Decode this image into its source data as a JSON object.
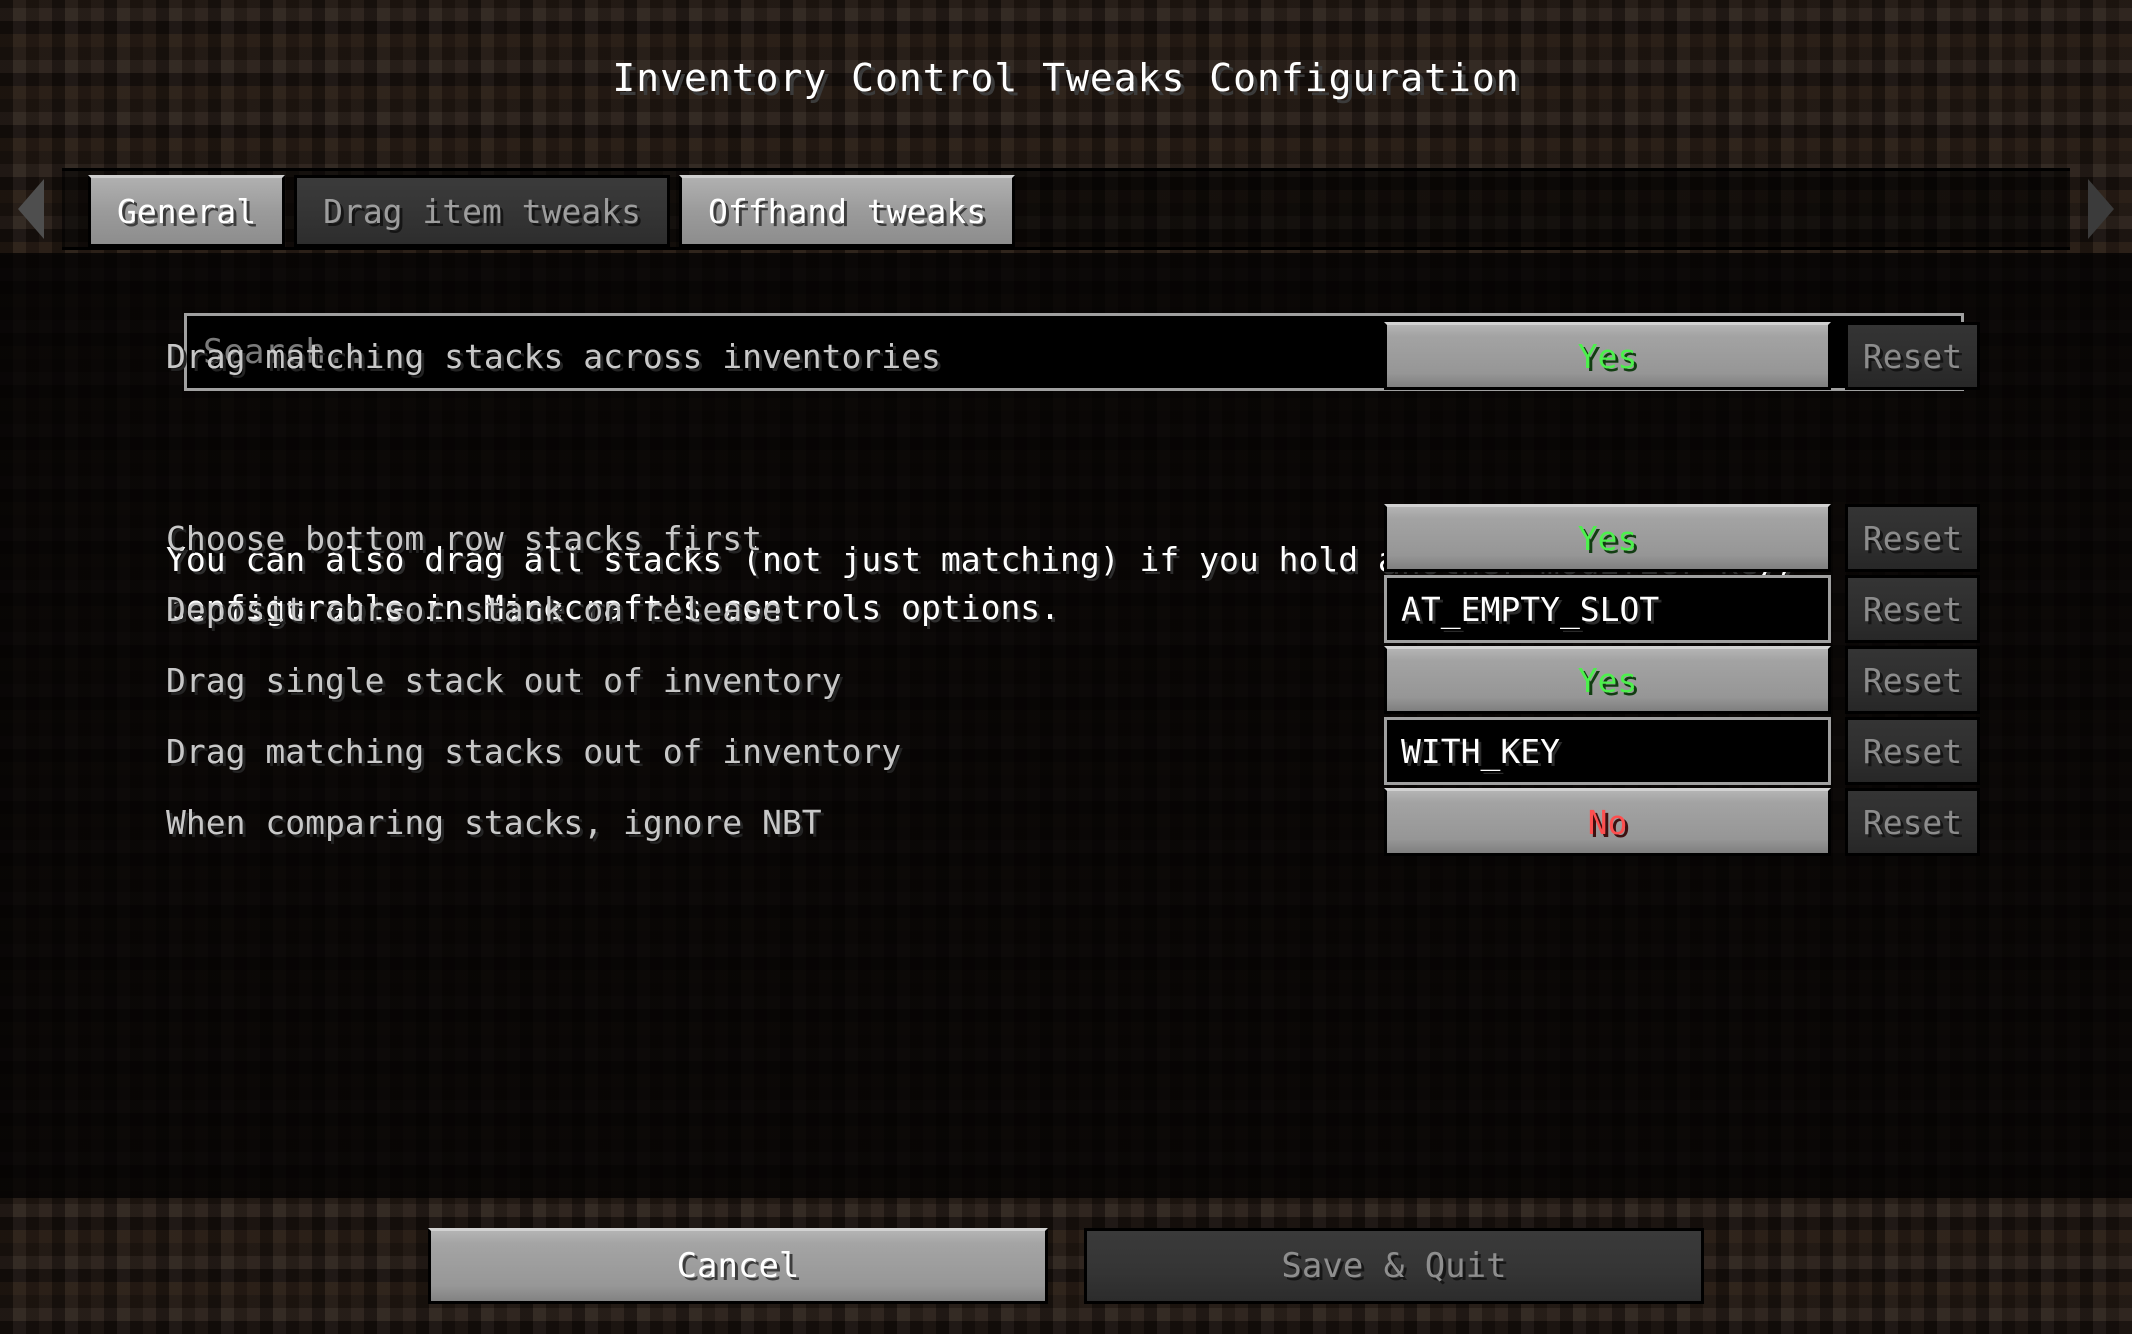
{
  "header": {
    "title": "Inventory Control Tweaks Configuration"
  },
  "tabs": {
    "prev_icon": "triangle-left-icon",
    "next_icon": "triangle-right-icon",
    "items": [
      {
        "label": "General",
        "state": "active"
      },
      {
        "label": "Drag item tweaks",
        "state": "inactive"
      },
      {
        "label": "Offhand tweaks",
        "state": "active"
      }
    ]
  },
  "search": {
    "placeholder": "Search...",
    "value": ""
  },
  "options": [
    {
      "label": "Drag matching stacks across inventories",
      "control_type": "toggle",
      "value": "Yes",
      "value_color": "#4df04d",
      "reset_label": "Reset"
    },
    {
      "label": "Choose bottom row stacks first",
      "control_type": "toggle",
      "value": "Yes",
      "value_color": "#4df04d",
      "reset_label": "Reset"
    },
    {
      "label": "Deposit cursor stack on release",
      "control_type": "textfield",
      "value": "AT_EMPTY_SLOT",
      "value_color": "#ffffff",
      "reset_label": "Reset"
    },
    {
      "label": "Drag single stack out of inventory",
      "control_type": "toggle",
      "value": "Yes",
      "value_color": "#4df04d",
      "reset_label": "Reset"
    },
    {
      "label": "Drag matching stacks out of inventory",
      "control_type": "textfield",
      "value": "WITH_KEY",
      "value_color": "#ffffff",
      "reset_label": "Reset"
    },
    {
      "label": "When comparing stacks, ignore NBT",
      "control_type": "toggle",
      "value": "No",
      "value_color": "#fd4f4f",
      "reset_label": "Reset"
    }
  ],
  "description": {
    "line1": "You can also drag all stacks (not just matching) if you hold another modifier key,",
    "line2": "configurable in Minecraft's controls options."
  },
  "footer": {
    "cancel_label": "Cancel",
    "save_label": "Save & Quit"
  },
  "colors": {
    "background": "#241a13",
    "panel": "#050302",
    "value_true": "#4df04d",
    "value_false": "#fd4f4f",
    "label": "#c8c8c8"
  }
}
